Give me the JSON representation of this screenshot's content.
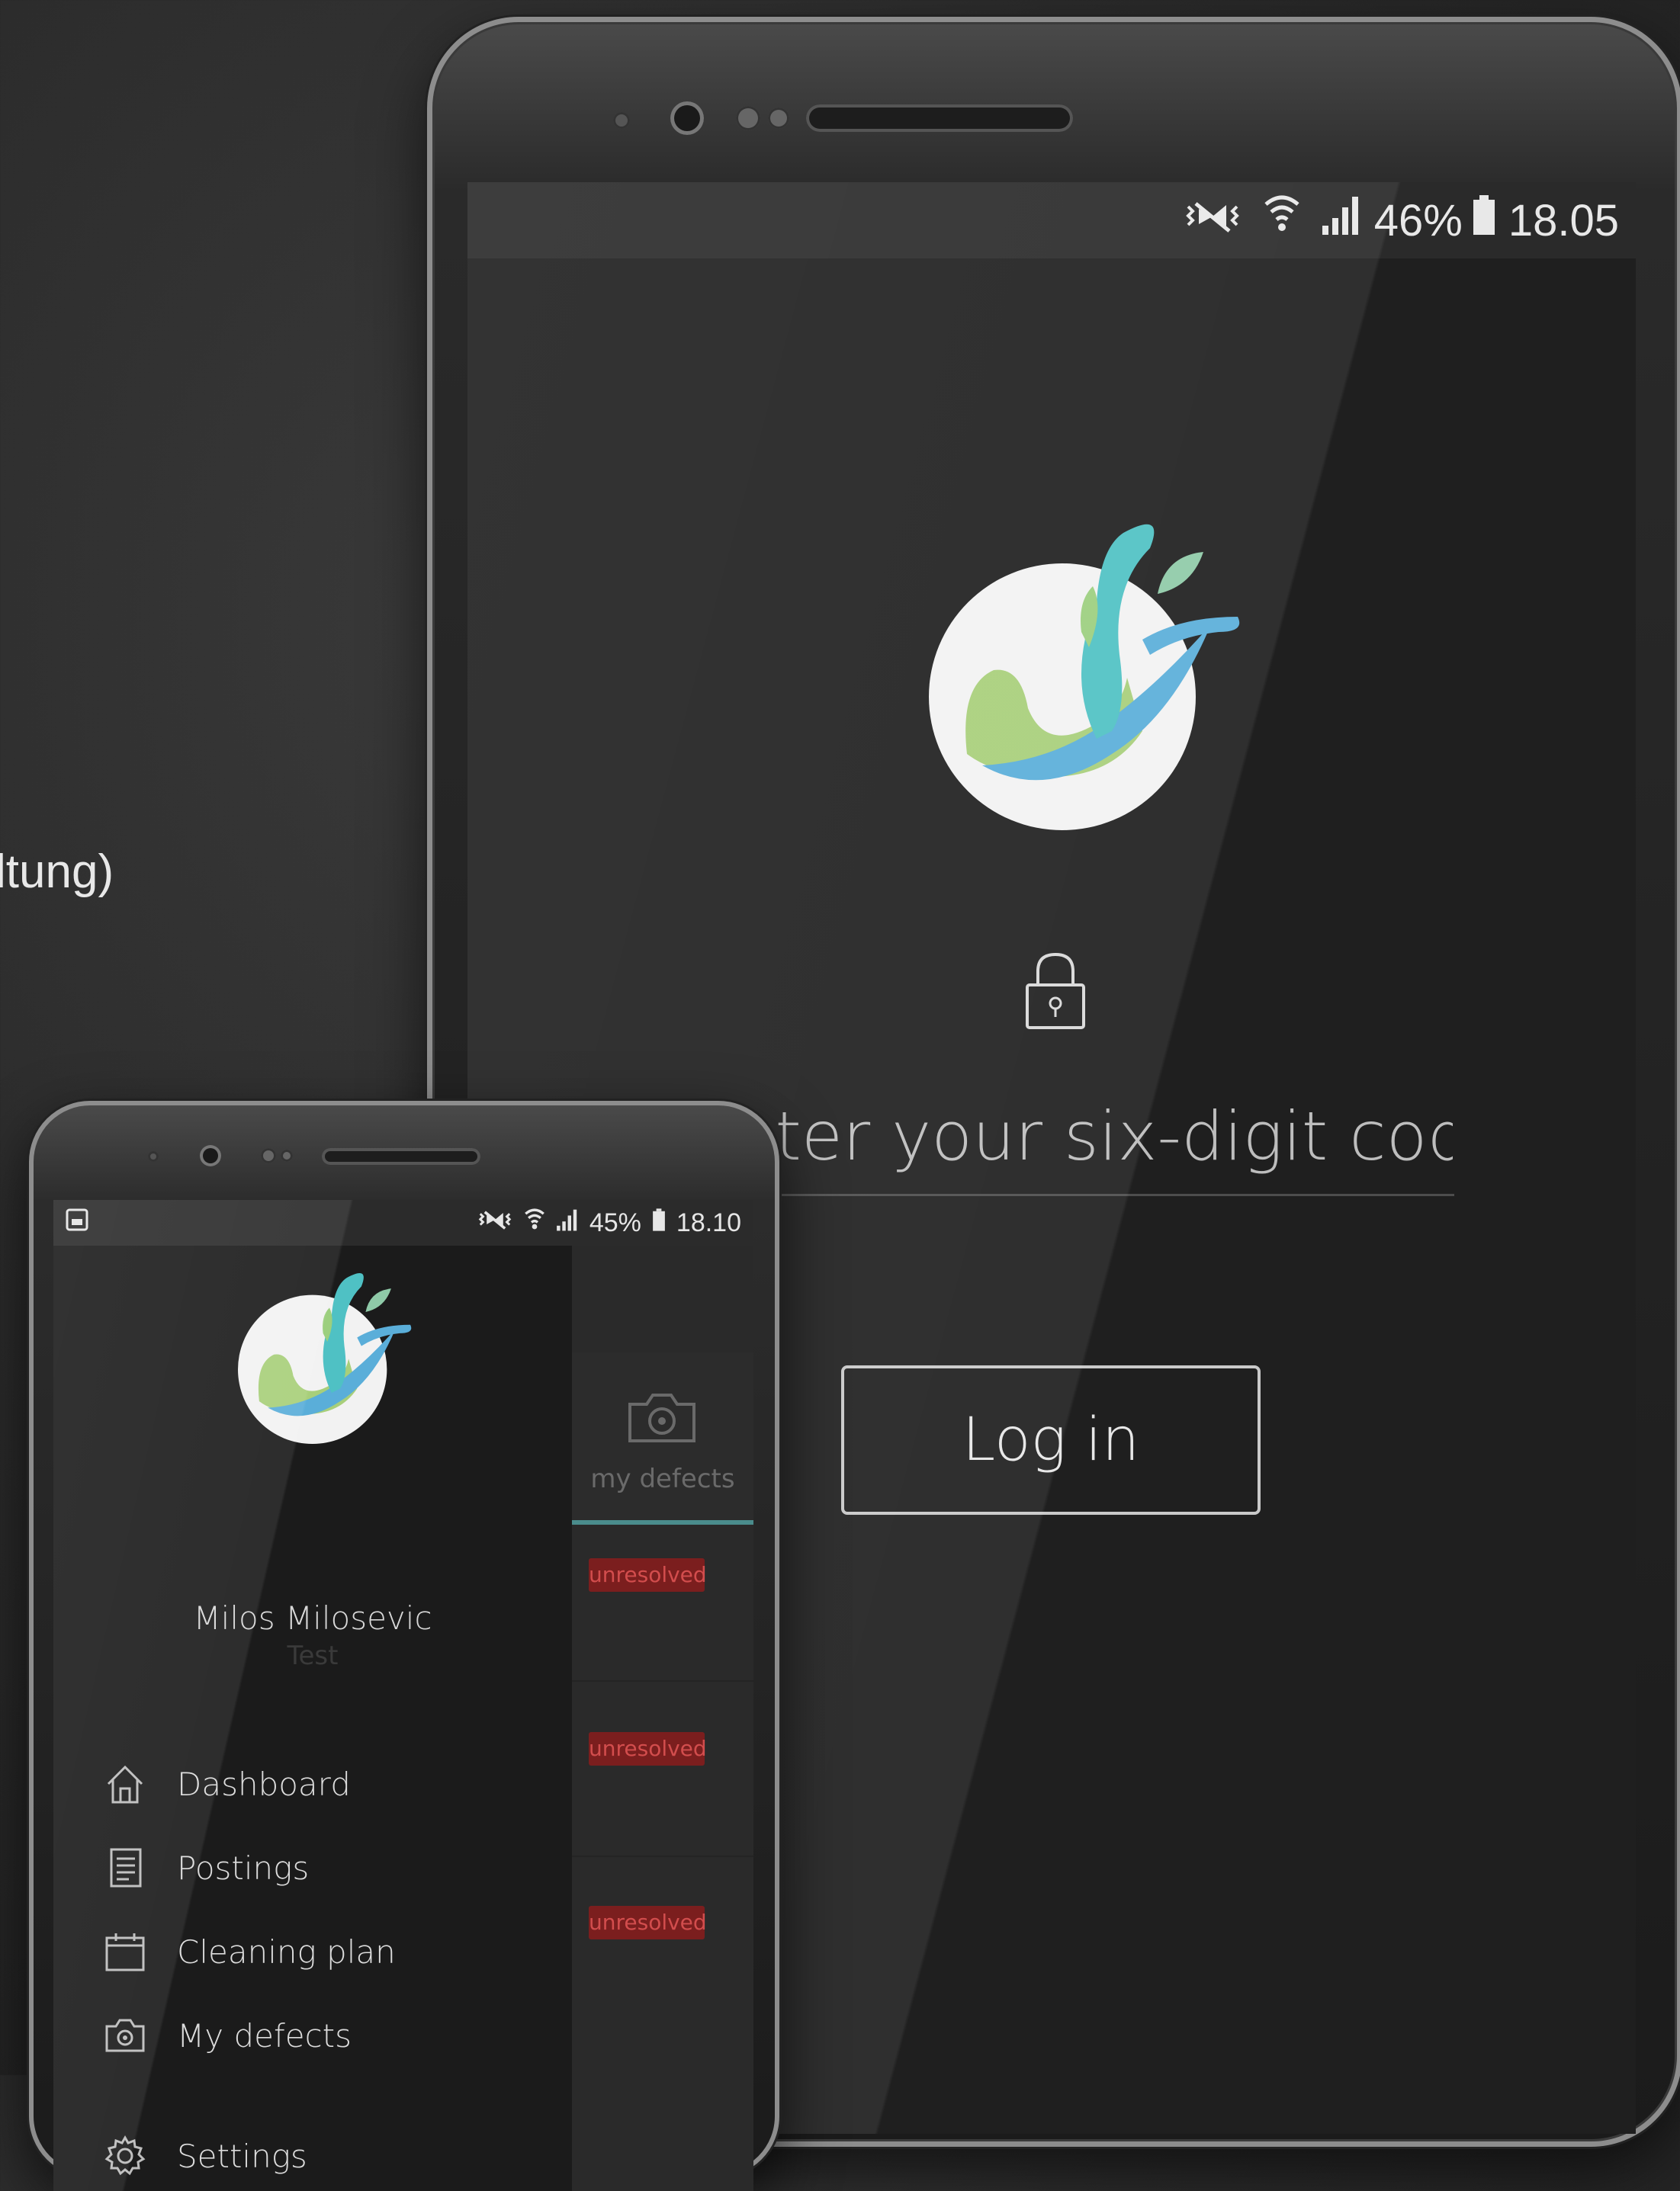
{
  "background_text": "ltung)",
  "big_phone": {
    "status": {
      "battery_percent": "46%",
      "time": "18.05"
    },
    "lock_icon": "lock-icon",
    "code_placeholder": "Enter your six-digit code",
    "login_label": "Log in"
  },
  "small_phone": {
    "status": {
      "battery_percent": "45%",
      "time": "18.10"
    },
    "user": {
      "name": "Milos Milosevic",
      "role": "Test"
    },
    "nav": [
      {
        "label": "Dashboard",
        "icon": "home-icon"
      },
      {
        "label": "Postings",
        "icon": "document-icon"
      },
      {
        "label": "Cleaning plan",
        "icon": "calendar-icon"
      },
      {
        "label": "My defects",
        "icon": "camera-icon"
      },
      {
        "label": "Settings",
        "icon": "gear-icon"
      }
    ],
    "tab": {
      "label": "my defects",
      "icon": "camera-icon"
    },
    "badges": [
      "unresolved",
      "unresolved",
      "unresolved"
    ]
  },
  "colors": {
    "accent_teal": "#4a8c8c",
    "badge_bg": "#7b1e1e",
    "badge_text": "#d24d4d"
  }
}
